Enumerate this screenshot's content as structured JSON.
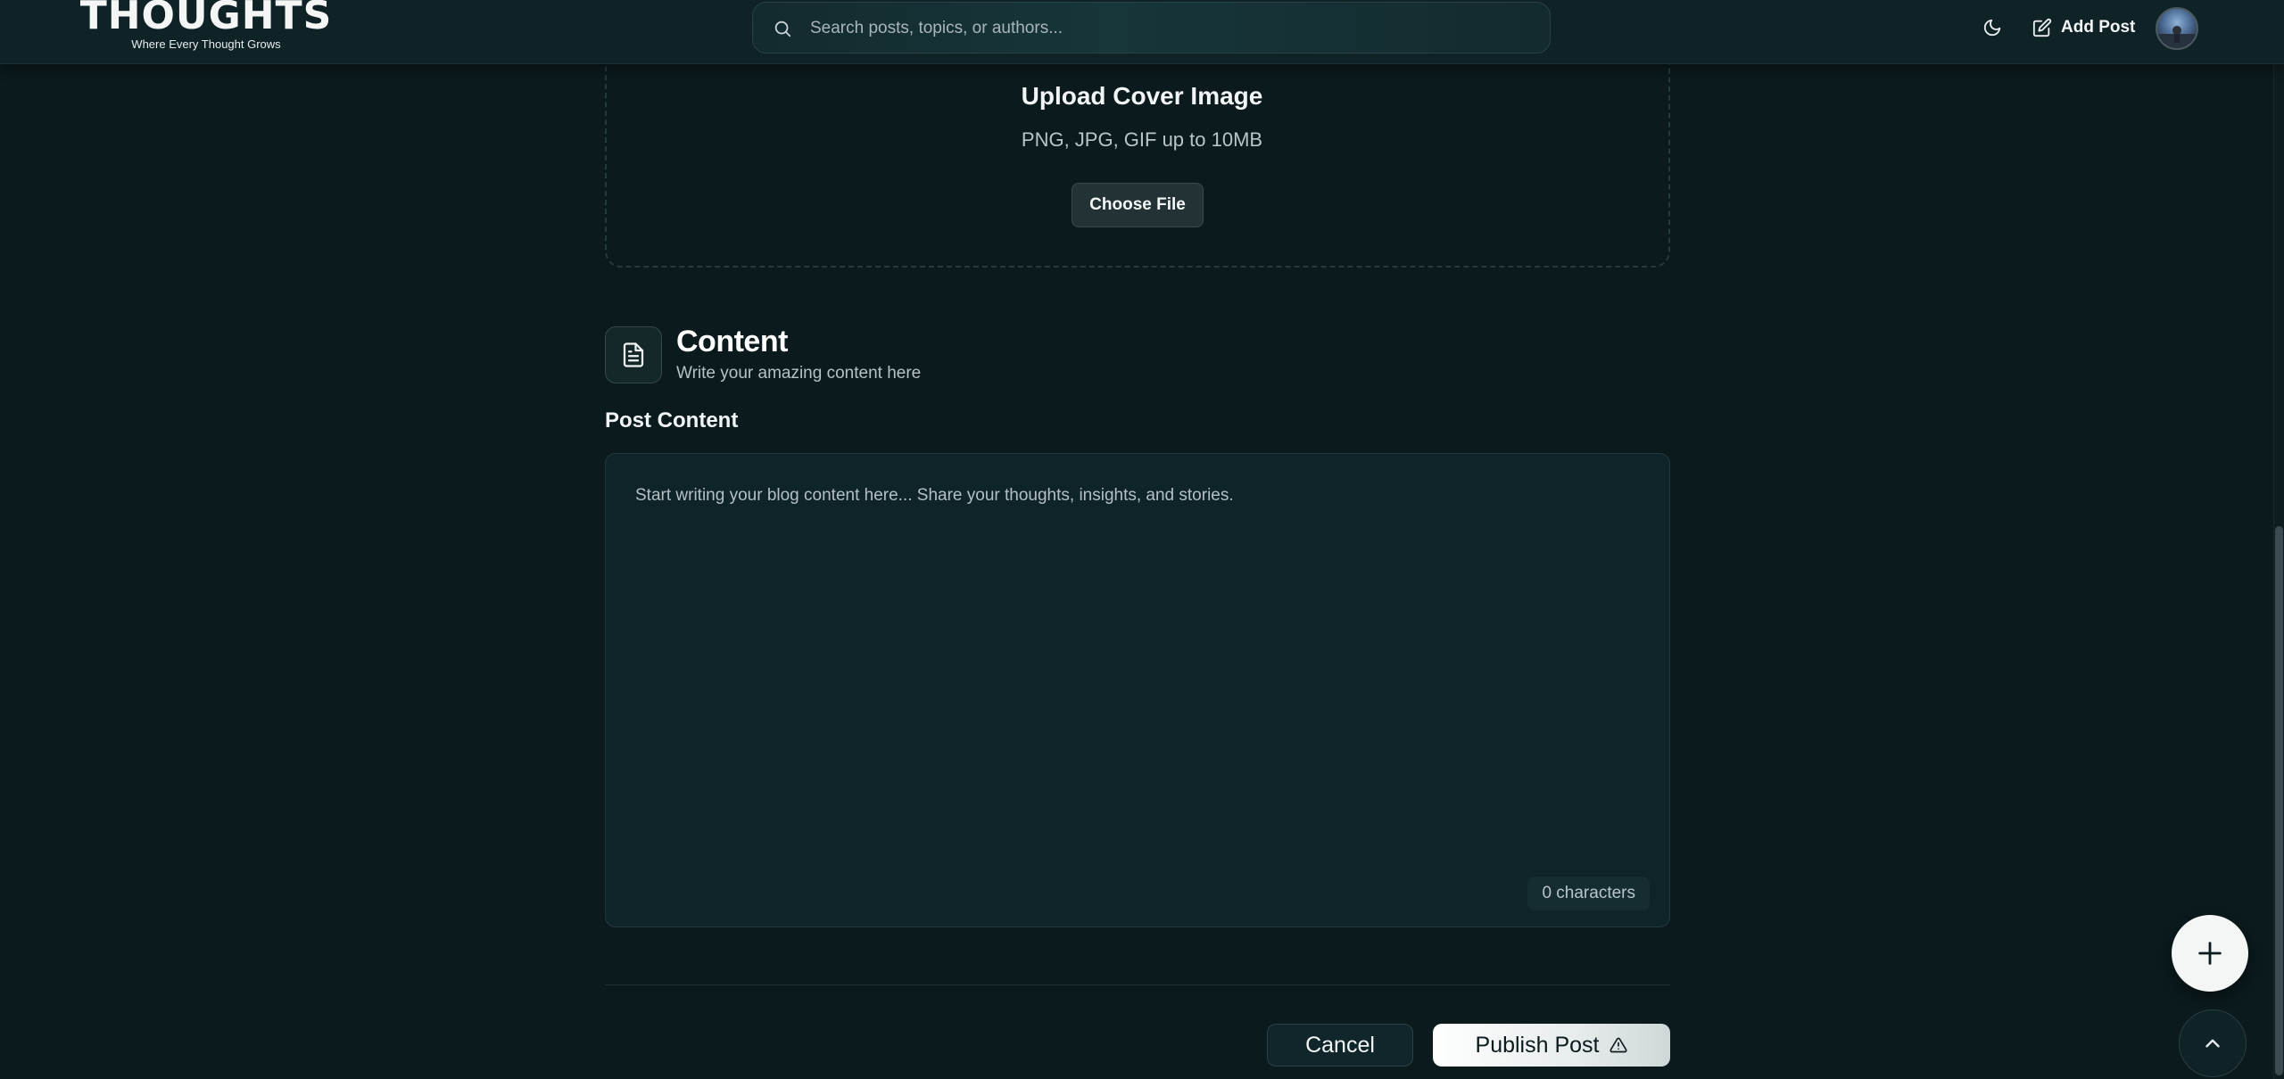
{
  "header": {
    "logo_text": "THOUGHTS",
    "tagline": "Where Every Thought Grows",
    "search_placeholder": "Search posts, topics, or authors...",
    "add_post_label": "Add Post"
  },
  "upload": {
    "title": "Upload Cover Image",
    "subtitle": "PNG, JPG, GIF up to 10MB",
    "button_label": "Choose File"
  },
  "content_section": {
    "title": "Content",
    "subtitle": "Write your amazing content here",
    "field_label": "Post Content",
    "placeholder": "Start writing your blog content here... Share your thoughts, insights, and stories.",
    "char_count": "0 characters"
  },
  "actions": {
    "cancel_label": "Cancel",
    "publish_label": "Publish Post"
  },
  "icons": {
    "search": "search-icon",
    "theme": "moon-icon",
    "add_post": "edit-icon",
    "content": "document-icon",
    "publish": "warning-icon",
    "fab_add": "plus-icon",
    "fab_top": "chevron-up-icon"
  },
  "colors": {
    "background": "#0b1a1d",
    "header": "#0f2226",
    "editor": "#0f2428",
    "text": "#e8eef0",
    "muted": "#b6c2c5"
  }
}
